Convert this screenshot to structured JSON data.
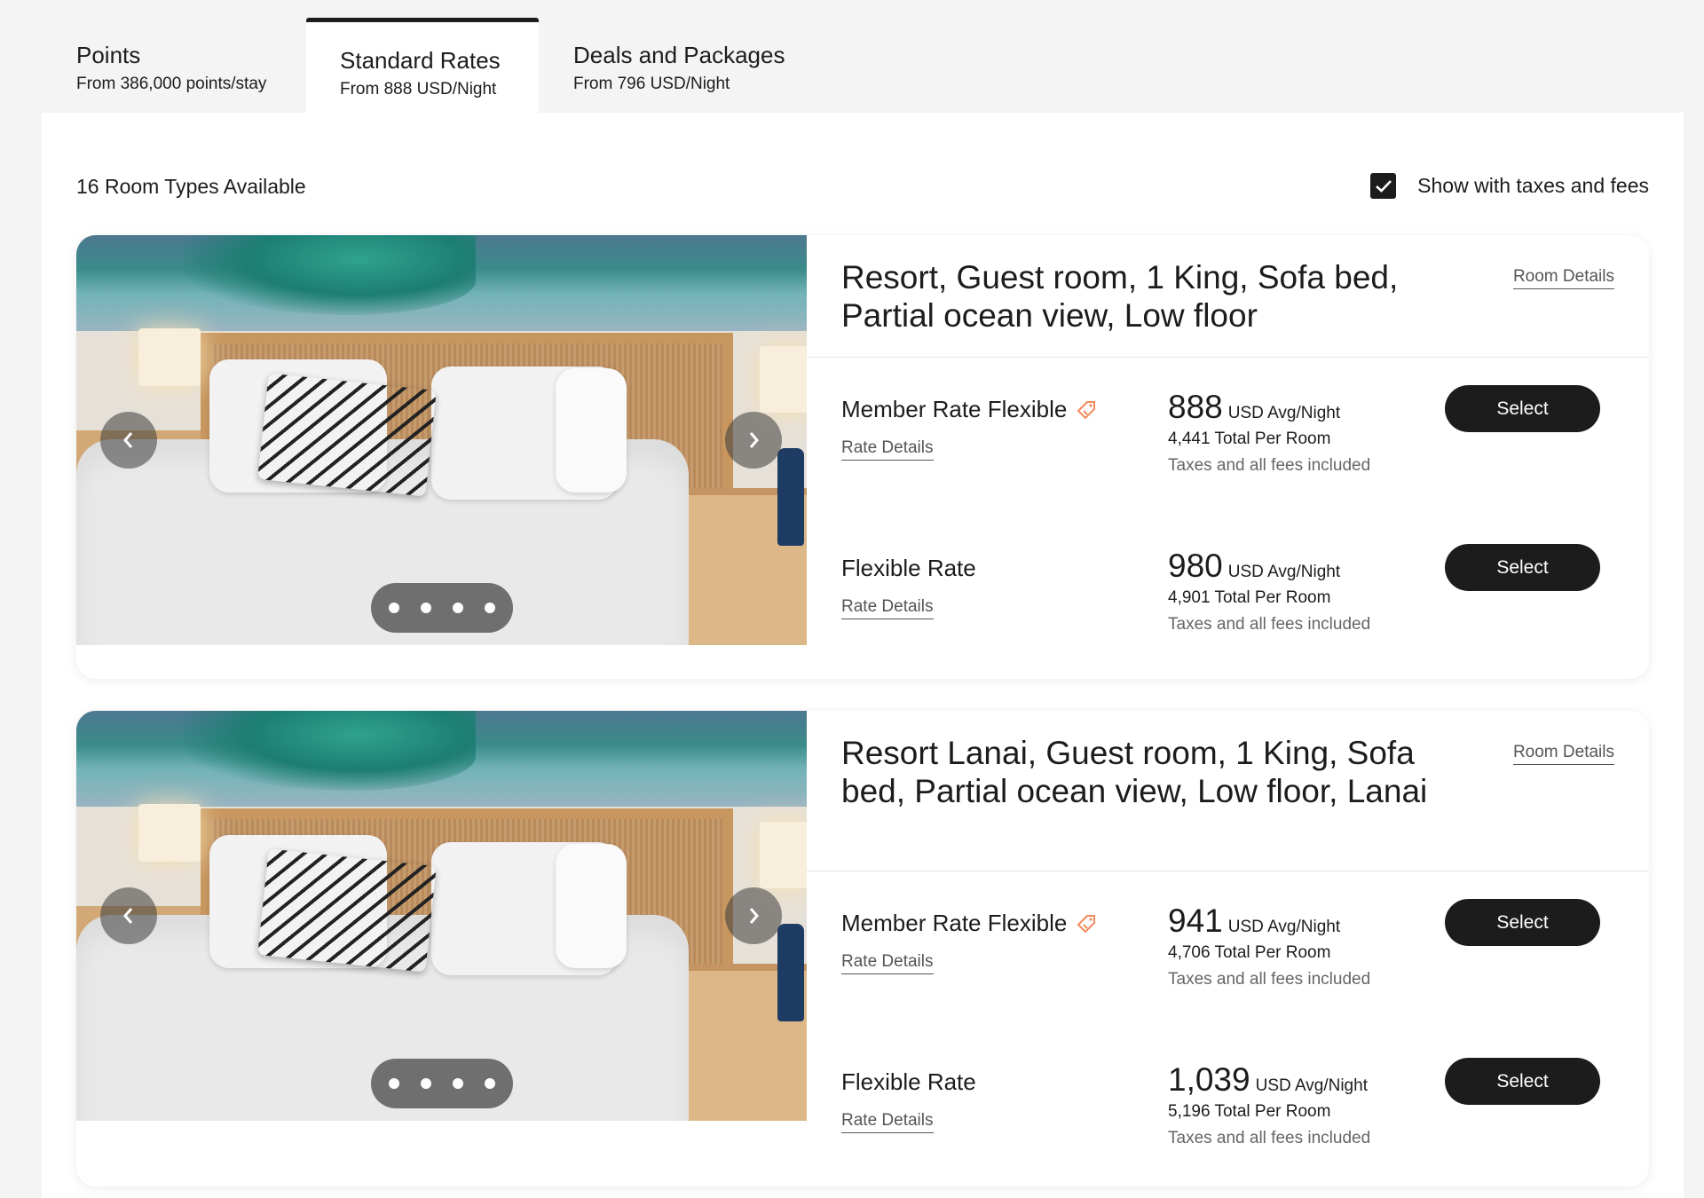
{
  "tabs": [
    {
      "title": "Points",
      "subtitle": "From 386,000 points/stay"
    },
    {
      "title": "Standard Rates",
      "subtitle": "From 888 USD/Night"
    },
    {
      "title": "Deals and Packages",
      "subtitle": "From 796 USD/Night"
    }
  ],
  "active_tab": "Standard Rates",
  "availability": "16 Room Types Available",
  "taxes_toggle": {
    "label": "Show with taxes and fees",
    "checked": true
  },
  "rooms": [
    {
      "title": "Resort, Guest room, 1 King, Sofa bed, Partial ocean view, Low floor",
      "details_link": "Room Details",
      "carousel_dots": 4,
      "rates": [
        {
          "name": "Member Rate Flexible",
          "details_link": "Rate Details",
          "price": "888",
          "unit": "USD Avg/Night",
          "total": "4,441 Total Per Room",
          "note": "Taxes and all fees included",
          "button": "Select"
        },
        {
          "name": "Flexible Rate",
          "details_link": "Rate Details",
          "price": "980",
          "unit": "USD Avg/Night",
          "total": "4,901 Total Per Room",
          "note": "Taxes and all fees included",
          "button": "Select"
        }
      ]
    },
    {
      "title": "Resort Lanai, Guest room, 1 King, Sofa bed, Partial ocean view, Low floor, Lanai",
      "details_link": "Room Details",
      "carousel_dots": 4,
      "rates": [
        {
          "name": "Member Rate Flexible",
          "details_link": "Rate Details",
          "price": "941",
          "unit": "USD Avg/Night",
          "total": "4,706 Total Per Room",
          "note": "Taxes and all fees included",
          "button": "Select"
        },
        {
          "name": "Flexible Rate",
          "details_link": "Rate Details",
          "price": "1,039",
          "unit": "USD Avg/Night",
          "total": "5,196 Total Per Room",
          "note": "Taxes and all fees included",
          "button": "Select"
        }
      ]
    }
  ],
  "icons": {
    "member_tag": "tag-icon",
    "checkbox": "check-icon",
    "prev": "chevron-left-icon",
    "next": "chevron-right-icon"
  },
  "colors": {
    "primary": "#1c1c1c",
    "member_tag": "#f28a5c",
    "background": "#f4f4f4"
  }
}
